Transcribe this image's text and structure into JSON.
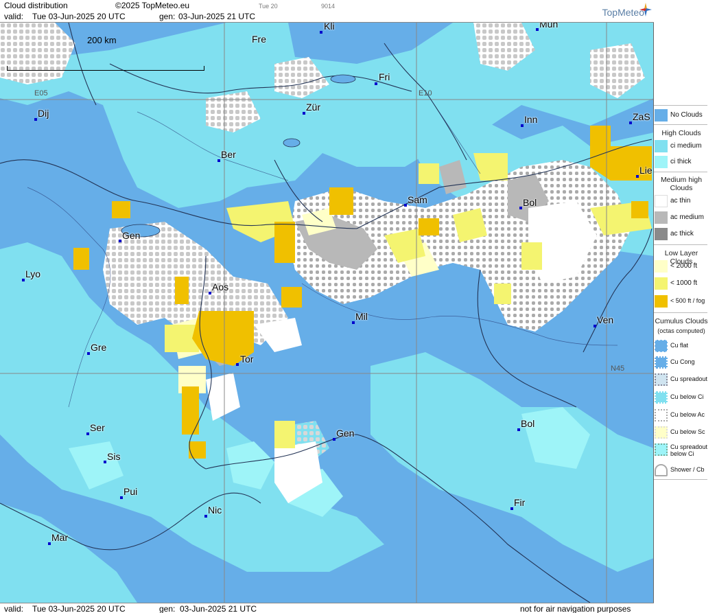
{
  "header": {
    "title": "Cloud distribution",
    "copyright": "©2025 TopMeteo.eu",
    "valid_label": "valid:",
    "valid_value": "Tue  03-Jun-2025  20 UTC",
    "gen_label": "gen:",
    "gen_value": "03-Jun-2025 21 UTC",
    "small_day": "Tue 20",
    "small_code": "9014",
    "logo": "TopMeteo"
  },
  "footer": {
    "valid_label": "valid:",
    "valid_value": "Tue  03-Jun-2025  20 UTC",
    "gen_label": "gen:",
    "gen_value": "03-Jun-2025 21 UTC",
    "disclaimer": "not for air navigation purposes"
  },
  "map": {
    "scale_label": "200 km",
    "grid_labels": [
      "E05",
      "E10",
      "N45"
    ],
    "cities": [
      {
        "name": "Kli"
      },
      {
        "name": "Mün"
      },
      {
        "name": "Fre"
      },
      {
        "name": "Fri"
      },
      {
        "name": "Dij"
      },
      {
        "name": "Zür"
      },
      {
        "name": "Inn"
      },
      {
        "name": "ZaS"
      },
      {
        "name": "Ber"
      },
      {
        "name": "Lie"
      },
      {
        "name": "Sam"
      },
      {
        "name": "Bol"
      },
      {
        "name": "Gen"
      },
      {
        "name": "Lyo"
      },
      {
        "name": "Aos"
      },
      {
        "name": "Mil"
      },
      {
        "name": "Ven"
      },
      {
        "name": "Gre"
      },
      {
        "name": "Tor"
      },
      {
        "name": "Ser"
      },
      {
        "name": "Gen"
      },
      {
        "name": "Bol"
      },
      {
        "name": "Sis"
      },
      {
        "name": "Pui"
      },
      {
        "name": "Nic"
      },
      {
        "name": "Fir"
      },
      {
        "name": "Mar"
      }
    ]
  },
  "legend": {
    "no_clouds": "No Clouds",
    "high_title": "High Clouds",
    "high_items": [
      "ci medium",
      "ci thick"
    ],
    "medium_title": "Medium high Clouds",
    "medium_items": [
      "ac thin",
      "ac medium",
      "ac thick"
    ],
    "low_title": "Low Layer Clouds",
    "low_items": [
      "< 2000 ft",
      "< 1000 ft",
      "< 500 ft / fog"
    ],
    "cumulus_title": "Cumulus Clouds",
    "cumulus_sub": "(octas computed)",
    "cumulus_items": [
      "Cu flat",
      "Cu Cong",
      "Cu spreadout",
      "Cu below Ci",
      "Cu below Ac",
      "Cu below Sc",
      "Cu spreadout below Ci",
      "Shower / Cb"
    ]
  },
  "colors": {
    "no_clouds": "#66aee8",
    "ci_medium": "#80e0f0",
    "ci_thick": "#9ef4f8",
    "ac_thin": "#ffffff",
    "ac_medium": "#b8b8b8",
    "ac_thick": "#8a8a8a",
    "low_2000": "#ffffc8",
    "low_1000": "#f4f470",
    "low_500": "#f0c000",
    "city_dot": "#0000cc"
  }
}
